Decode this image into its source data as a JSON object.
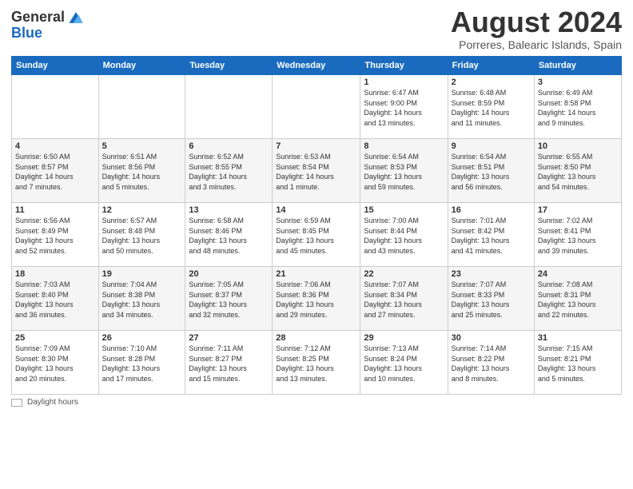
{
  "logo": {
    "general": "General",
    "blue": "Blue"
  },
  "title": "August 2024",
  "location": "Porreres, Balearic Islands, Spain",
  "days_header": [
    "Sunday",
    "Monday",
    "Tuesday",
    "Wednesday",
    "Thursday",
    "Friday",
    "Saturday"
  ],
  "footer_label": "Daylight hours",
  "weeks": [
    [
      {
        "day": "",
        "info": ""
      },
      {
        "day": "",
        "info": ""
      },
      {
        "day": "",
        "info": ""
      },
      {
        "day": "",
        "info": ""
      },
      {
        "day": "1",
        "info": "Sunrise: 6:47 AM\nSunset: 9:00 PM\nDaylight: 14 hours\nand 13 minutes."
      },
      {
        "day": "2",
        "info": "Sunrise: 6:48 AM\nSunset: 8:59 PM\nDaylight: 14 hours\nand 11 minutes."
      },
      {
        "day": "3",
        "info": "Sunrise: 6:49 AM\nSunset: 8:58 PM\nDaylight: 14 hours\nand 9 minutes."
      }
    ],
    [
      {
        "day": "4",
        "info": "Sunrise: 6:50 AM\nSunset: 8:57 PM\nDaylight: 14 hours\nand 7 minutes."
      },
      {
        "day": "5",
        "info": "Sunrise: 6:51 AM\nSunset: 8:56 PM\nDaylight: 14 hours\nand 5 minutes."
      },
      {
        "day": "6",
        "info": "Sunrise: 6:52 AM\nSunset: 8:55 PM\nDaylight: 14 hours\nand 3 minutes."
      },
      {
        "day": "7",
        "info": "Sunrise: 6:53 AM\nSunset: 8:54 PM\nDaylight: 14 hours\nand 1 minute."
      },
      {
        "day": "8",
        "info": "Sunrise: 6:54 AM\nSunset: 8:53 PM\nDaylight: 13 hours\nand 59 minutes."
      },
      {
        "day": "9",
        "info": "Sunrise: 6:54 AM\nSunset: 8:51 PM\nDaylight: 13 hours\nand 56 minutes."
      },
      {
        "day": "10",
        "info": "Sunrise: 6:55 AM\nSunset: 8:50 PM\nDaylight: 13 hours\nand 54 minutes."
      }
    ],
    [
      {
        "day": "11",
        "info": "Sunrise: 6:56 AM\nSunset: 8:49 PM\nDaylight: 13 hours\nand 52 minutes."
      },
      {
        "day": "12",
        "info": "Sunrise: 6:57 AM\nSunset: 8:48 PM\nDaylight: 13 hours\nand 50 minutes."
      },
      {
        "day": "13",
        "info": "Sunrise: 6:58 AM\nSunset: 8:46 PM\nDaylight: 13 hours\nand 48 minutes."
      },
      {
        "day": "14",
        "info": "Sunrise: 6:59 AM\nSunset: 8:45 PM\nDaylight: 13 hours\nand 45 minutes."
      },
      {
        "day": "15",
        "info": "Sunrise: 7:00 AM\nSunset: 8:44 PM\nDaylight: 13 hours\nand 43 minutes."
      },
      {
        "day": "16",
        "info": "Sunrise: 7:01 AM\nSunset: 8:42 PM\nDaylight: 13 hours\nand 41 minutes."
      },
      {
        "day": "17",
        "info": "Sunrise: 7:02 AM\nSunset: 8:41 PM\nDaylight: 13 hours\nand 39 minutes."
      }
    ],
    [
      {
        "day": "18",
        "info": "Sunrise: 7:03 AM\nSunset: 8:40 PM\nDaylight: 13 hours\nand 36 minutes."
      },
      {
        "day": "19",
        "info": "Sunrise: 7:04 AM\nSunset: 8:38 PM\nDaylight: 13 hours\nand 34 minutes."
      },
      {
        "day": "20",
        "info": "Sunrise: 7:05 AM\nSunset: 8:37 PM\nDaylight: 13 hours\nand 32 minutes."
      },
      {
        "day": "21",
        "info": "Sunrise: 7:06 AM\nSunset: 8:36 PM\nDaylight: 13 hours\nand 29 minutes."
      },
      {
        "day": "22",
        "info": "Sunrise: 7:07 AM\nSunset: 8:34 PM\nDaylight: 13 hours\nand 27 minutes."
      },
      {
        "day": "23",
        "info": "Sunrise: 7:07 AM\nSunset: 8:33 PM\nDaylight: 13 hours\nand 25 minutes."
      },
      {
        "day": "24",
        "info": "Sunrise: 7:08 AM\nSunset: 8:31 PM\nDaylight: 13 hours\nand 22 minutes."
      }
    ],
    [
      {
        "day": "25",
        "info": "Sunrise: 7:09 AM\nSunset: 8:30 PM\nDaylight: 13 hours\nand 20 minutes."
      },
      {
        "day": "26",
        "info": "Sunrise: 7:10 AM\nSunset: 8:28 PM\nDaylight: 13 hours\nand 17 minutes."
      },
      {
        "day": "27",
        "info": "Sunrise: 7:11 AM\nSunset: 8:27 PM\nDaylight: 13 hours\nand 15 minutes."
      },
      {
        "day": "28",
        "info": "Sunrise: 7:12 AM\nSunset: 8:25 PM\nDaylight: 13 hours\nand 13 minutes."
      },
      {
        "day": "29",
        "info": "Sunrise: 7:13 AM\nSunset: 8:24 PM\nDaylight: 13 hours\nand 10 minutes."
      },
      {
        "day": "30",
        "info": "Sunrise: 7:14 AM\nSunset: 8:22 PM\nDaylight: 13 hours\nand 8 minutes."
      },
      {
        "day": "31",
        "info": "Sunrise: 7:15 AM\nSunset: 8:21 PM\nDaylight: 13 hours\nand 5 minutes."
      }
    ]
  ]
}
